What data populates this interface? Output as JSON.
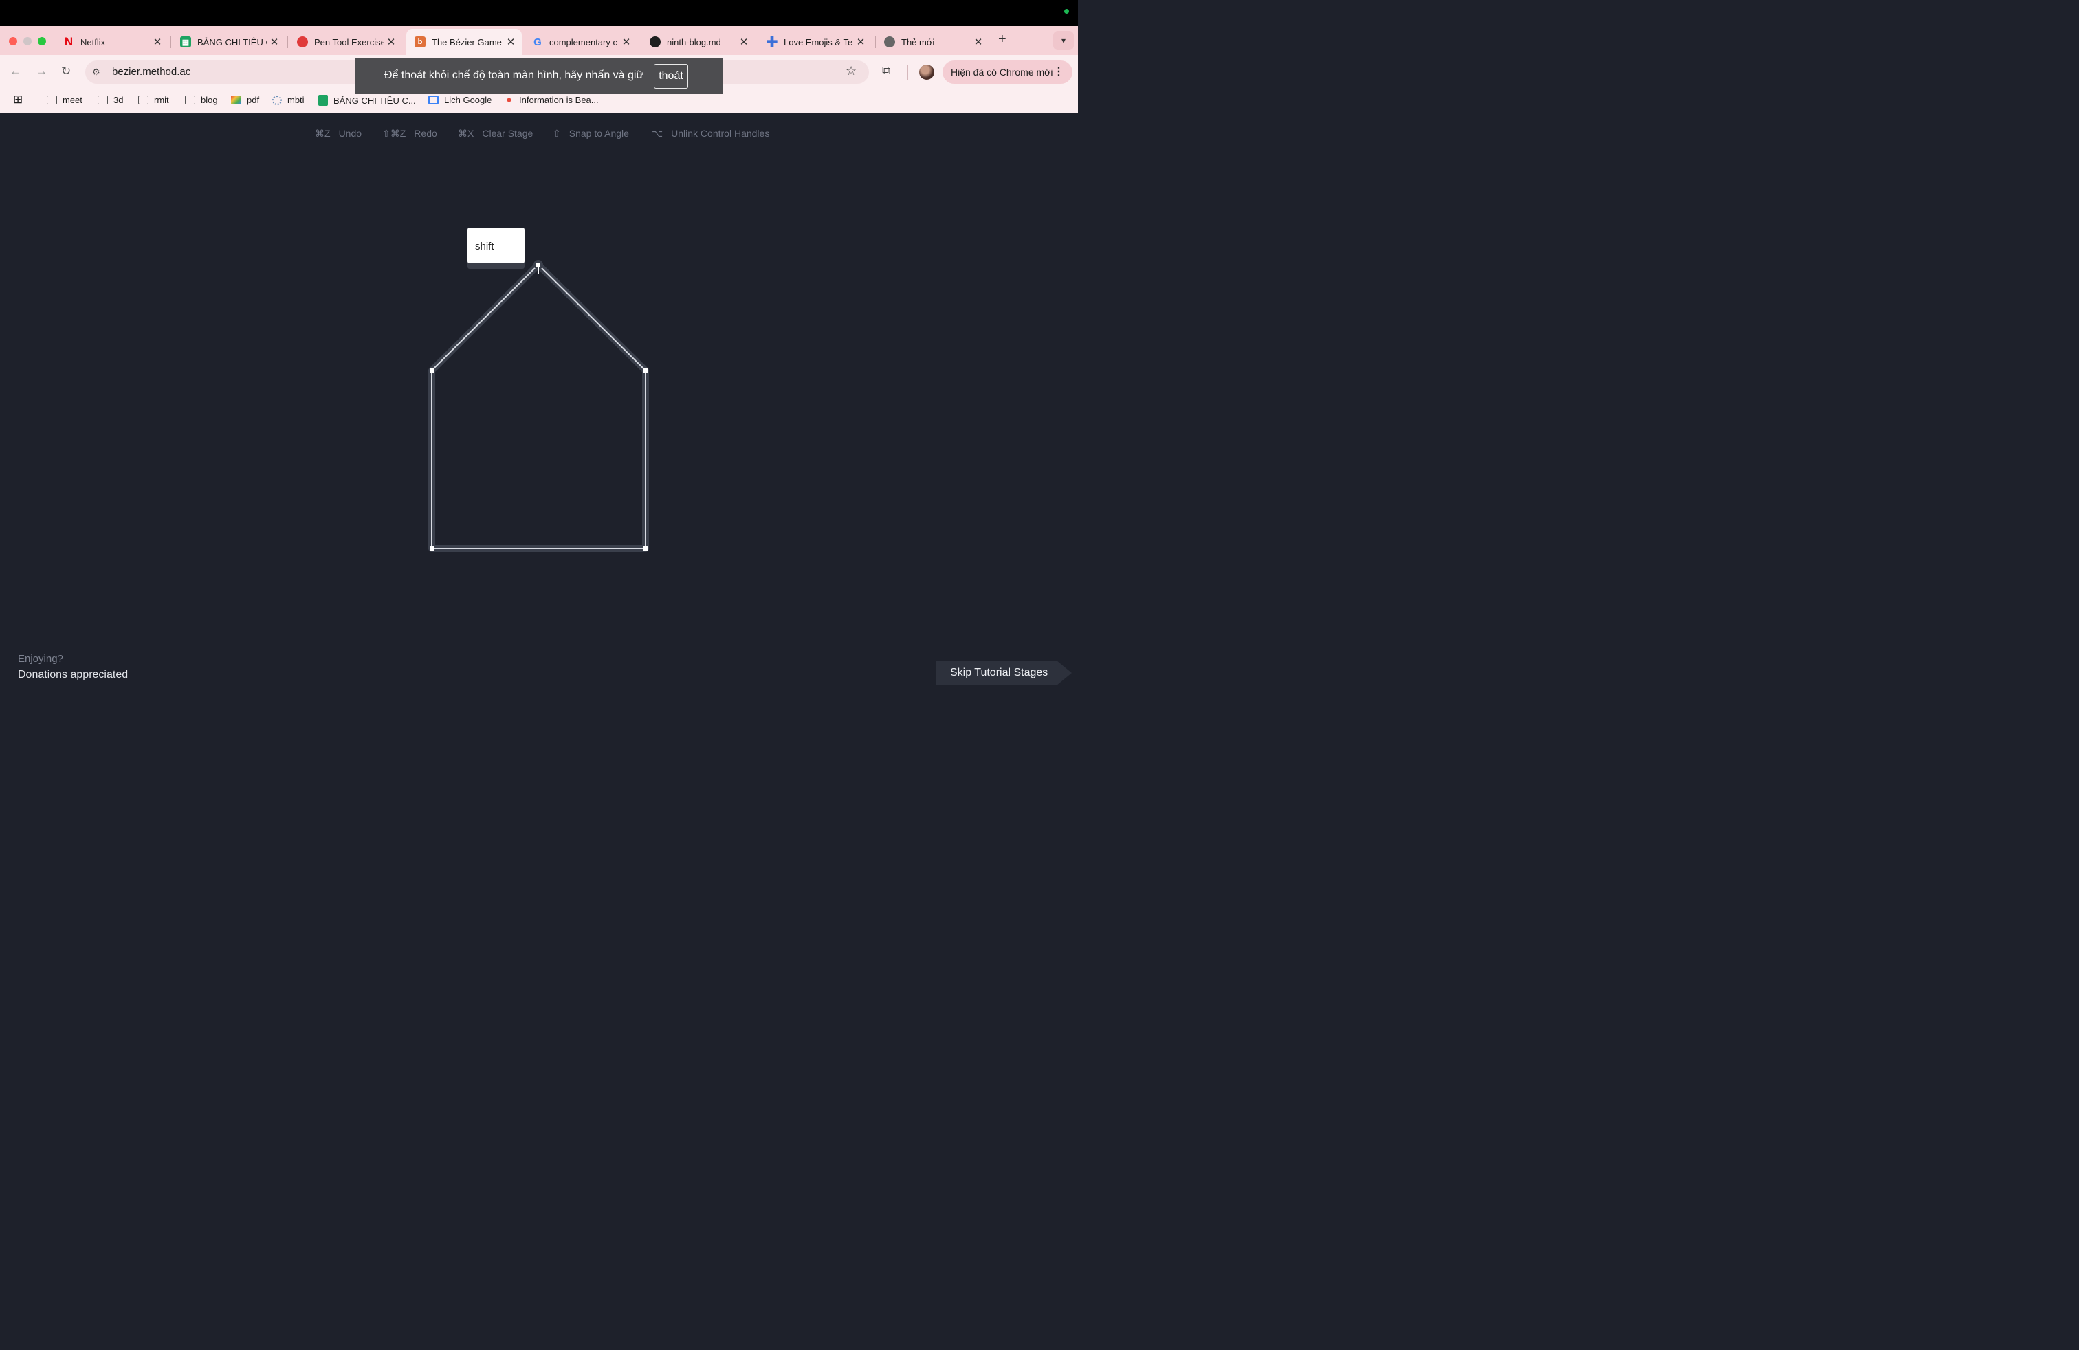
{
  "browser": {
    "tabs": [
      {
        "title": "Netflix",
        "icon": "netflix-icon",
        "color": "#e50914"
      },
      {
        "title": "BẢNG CHI TIÊU C",
        "icon": "sheets-icon",
        "color": "#1ea362"
      },
      {
        "title": "Pen Tool Exercise",
        "icon": "pen-tool-icon",
        "color": "#e03a3a"
      },
      {
        "title": "The Bézier Game",
        "icon": "bezier-icon",
        "color": "#e0703a",
        "active": true
      },
      {
        "title": "complementary c",
        "icon": "google-icon",
        "color": "#4285f4"
      },
      {
        "title": "ninth-blog.md —",
        "icon": "github-icon",
        "color": "#1f1f1f"
      },
      {
        "title": "Love Emojis & Te",
        "icon": "plus-icon",
        "color": "#3b6fd8"
      },
      {
        "title": "Thẻ mới",
        "icon": "chrome-icon",
        "color": "#555555"
      }
    ],
    "new_tab": "+",
    "url": "bezier.method.ac",
    "relaunch_button": "Hiện đã có Chrome mới",
    "bookmarks": [
      {
        "label": "meet",
        "icon": "folder-icon"
      },
      {
        "label": "3d",
        "icon": "folder-icon"
      },
      {
        "label": "rmit",
        "icon": "folder-icon"
      },
      {
        "label": "blog",
        "icon": "folder-icon"
      },
      {
        "label": "pdf",
        "icon": "pdf-icon"
      },
      {
        "label": "mbti",
        "icon": "mbti-icon"
      },
      {
        "label": "BẢNG CHI TIÊU C...",
        "icon": "sheets-icon"
      },
      {
        "label": "Lịch Google",
        "icon": "calendar-icon"
      },
      {
        "label": "Information is Bea...",
        "icon": "info-beautiful-icon"
      }
    ]
  },
  "fullscreen_toast": {
    "message": "Để thoát khỏi chế độ toàn màn hình, hãy nhấn và giữ",
    "key": "thoát"
  },
  "hints": [
    {
      "keys": "⌘Z",
      "label": "Undo"
    },
    {
      "keys": "⇧⌘Z",
      "label": "Redo"
    },
    {
      "keys": "⌘X",
      "label": "Clear Stage"
    },
    {
      "keys": "⇧",
      "label": "Snap to Angle"
    },
    {
      "keys": "⌥",
      "label": "Unlink Control Handles"
    }
  ],
  "shift_key_label": "shift",
  "footer": {
    "enjoy": "Enjoying?",
    "donate": "Donations appreciated",
    "skip": "Skip Tutorial Stages"
  },
  "colors": {
    "stage_bg": "#1e212b",
    "path_stroke": "#d8dbe2",
    "tab_bar": "#f6d3d8"
  }
}
